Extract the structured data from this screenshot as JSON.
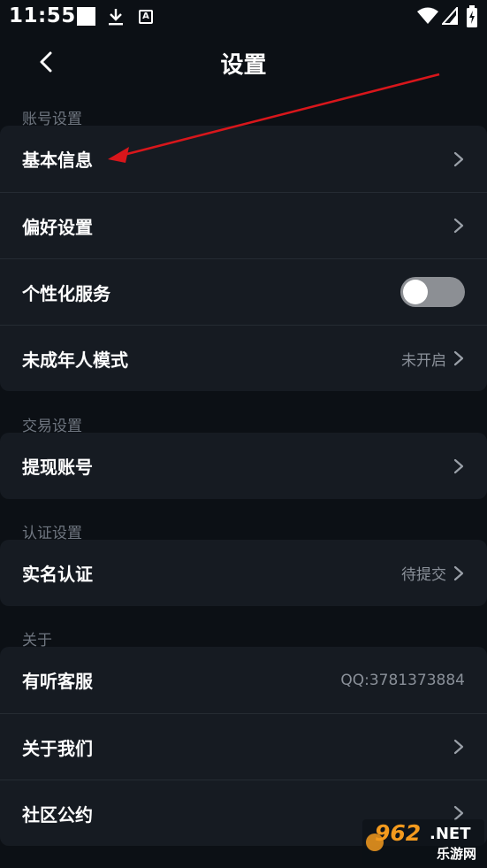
{
  "status_bar": {
    "time": "11:55",
    "a_glyph": "A",
    "icons": [
      "square-notification-icon",
      "download-icon",
      "a-notification-icon",
      "wifi-icon",
      "signal-icon",
      "battery-icon"
    ]
  },
  "header": {
    "title": "设置",
    "back_icon": "chevron-left-icon"
  },
  "sections": {
    "account": {
      "label": "账号设置",
      "items": [
        {
          "label": "基本信息",
          "value": ""
        },
        {
          "label": "偏好设置",
          "value": ""
        },
        {
          "label": "个性化服务",
          "toggle": false
        },
        {
          "label": "未成年人模式",
          "value": "未开启"
        }
      ]
    },
    "trade": {
      "label": "交易设置",
      "items": [
        {
          "label": "提现账号",
          "value": ""
        }
      ]
    },
    "auth": {
      "label": "认证设置",
      "items": [
        {
          "label": "实名认证",
          "value": "待提交"
        }
      ]
    },
    "about": {
      "label": "关于",
      "items": [
        {
          "label": "有听客服",
          "value": "QQ:3781373884"
        },
        {
          "label": "关于我们",
          "value": ""
        },
        {
          "label": "社区公约",
          "value": ""
        }
      ]
    }
  },
  "watermark": {
    "number": "962",
    "suffix": ".NET",
    "text": "乐游网"
  },
  "colors": {
    "background": "#0c1015",
    "card": "#161b22",
    "divider": "#252b33",
    "section_label": "#6f7680",
    "value_text": "#8a9099",
    "toggle_off": "#8c8f94",
    "annotation_arrow": "#d8161b",
    "watermark_orange": "#f39a1e"
  }
}
